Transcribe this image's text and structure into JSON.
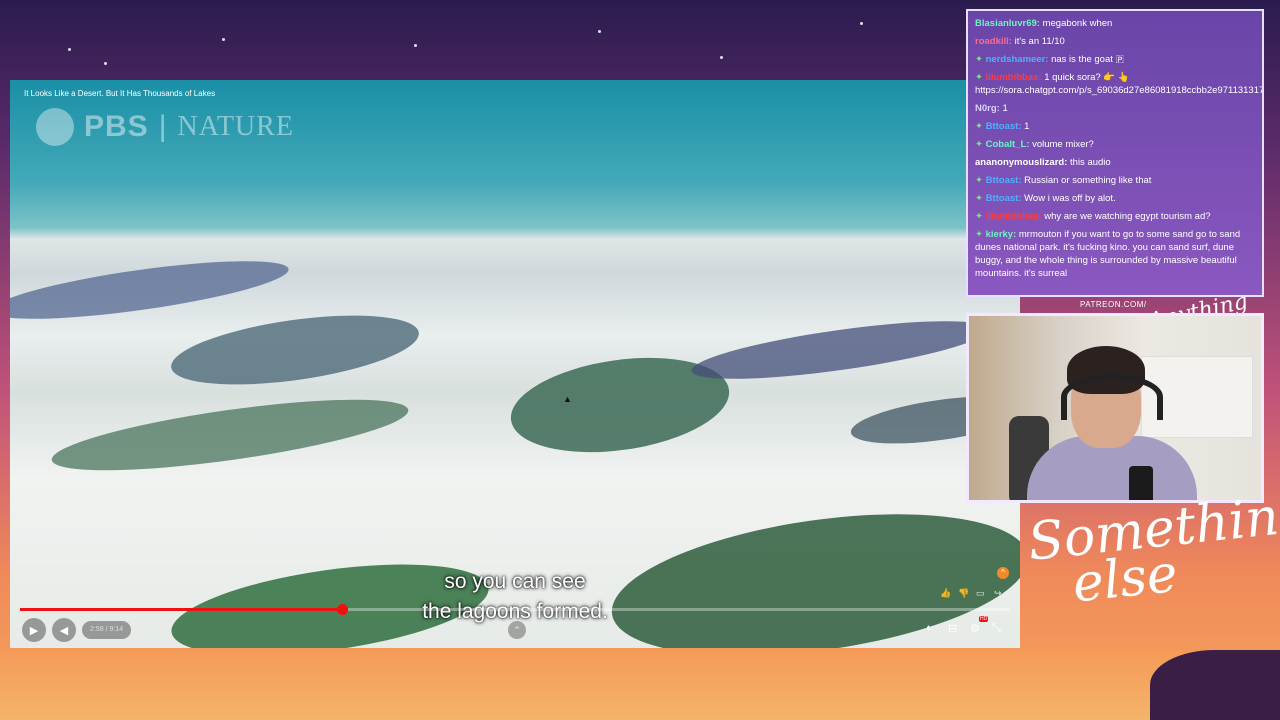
{
  "video": {
    "title": "It Looks Like a Desert. But It Has Thousands of Lakes",
    "logo": {
      "brand": "PBS",
      "separator": "|",
      "channel": "NATURE",
      "icon": "pbs-head-icon"
    },
    "captions": [
      "so you can see",
      "the lagoons formed."
    ],
    "time": "2:58 / 9:14",
    "progress": 0.325,
    "controls": {
      "play_icon": "▶",
      "volume_icon": "◀",
      "chevron_icon": "⌃",
      "alert_icon": "^",
      "like_icon": "👍",
      "dislike_icon": "👎",
      "comment_icon": "▭",
      "share_icon": "↪",
      "autoplay_icon": "◐",
      "subtitles_icon": "⊟",
      "settings_icon": "⚙",
      "hd_badge": "HD",
      "fullscreen_icon": "⤡"
    }
  },
  "chat": {
    "messages": [
      {
        "user": "Blasianluvr69:",
        "text": "megabonk when",
        "color": "#6ff2c8",
        "badge": false
      },
      {
        "user": "roadkill:",
        "text": "it's an 11/10",
        "color": "#ff6a8a",
        "badge": false
      },
      {
        "user": "nerdshameer:",
        "text": "nas is the goat 🇵",
        "color": "#4db0ff",
        "badge": true
      },
      {
        "user": "lilumbibbas:",
        "text": "1 quick sora? 👉 👆 https://sora.chatgpt.com/p/s_69036d27e86081918ccbb2e971131317",
        "color": "#ff3b3b",
        "badge": true
      },
      {
        "user": "N0rg:",
        "text": "1",
        "color": "#d8d0ff",
        "badge": false
      },
      {
        "user": "Bttoast:",
        "text": "1",
        "color": "#4db0ff",
        "badge": true
      },
      {
        "user": "Cobalt_L:",
        "text": "volume mixer?",
        "color": "#6ff2c8",
        "badge": true
      },
      {
        "user": "ananonymouslizard:",
        "text": "this audio",
        "color": "#ffffff",
        "badge": false
      },
      {
        "user": "Bttoast:",
        "text": "Russian or something like that",
        "color": "#4db0ff",
        "badge": true
      },
      {
        "user": "Bttoast:",
        "text": "Wow i was off by alot.",
        "color": "#4db0ff",
        "badge": true
      },
      {
        "user": "lilumbibbas:",
        "text": "why are we watching egypt tourism ad?",
        "color": "#ff3b3b",
        "badge": true
      },
      {
        "user": "kierky:",
        "text": "mrmouton if you want to go to some sand go to sand dunes national park. it's fucking kino. you can sand surf, dune buggy, and the whole thing is surrounded by massive beautiful mountains. it's surreal",
        "color": "#6ff2c8",
        "badge": true
      }
    ]
  },
  "overlay": {
    "patreon": "PATREON.COM/",
    "script_small": "Anything else",
    "script_logo": [
      "Something",
      "else"
    ]
  }
}
